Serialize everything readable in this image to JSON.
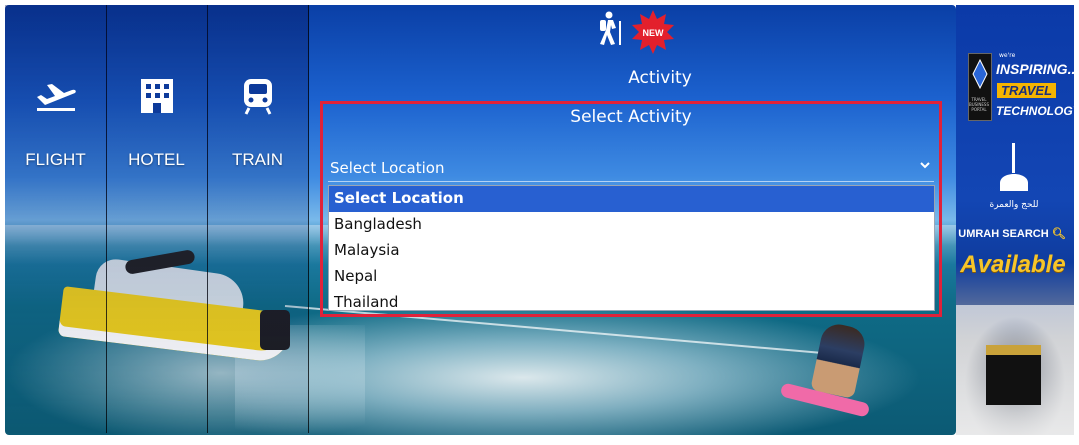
{
  "nav": {
    "tabs": [
      {
        "label": "FLIGHT",
        "icon": "airplane-departure-icon"
      },
      {
        "label": "HOTEL",
        "icon": "hotel-building-icon"
      },
      {
        "label": "TRAIN",
        "icon": "train-icon"
      }
    ]
  },
  "activity": {
    "label": "Activity",
    "icon": "hiker-icon",
    "badge": "NEW",
    "panel_title": "Select Activity",
    "location_select": {
      "value": "Select Location",
      "options": [
        "Select Location",
        "Bangladesh",
        "Malaysia",
        "Nepal",
        "Thailand"
      ],
      "selected_index": 0
    }
  },
  "ad": {
    "top_small": "we're",
    "inspiring": "INSPIRING...",
    "travel": "TRAVEL",
    "technology": "TECHNOLOGY",
    "logo_text": "TRAVEL BUSINESS PORTAL",
    "arabic_text": "للحج والعمرة",
    "umrah_search": "UMRAH SEARCH",
    "available": "Available"
  },
  "colors": {
    "highlight_border": "#e0223a",
    "option_selected_bg": "#2860d1",
    "badge_red": "#e3202c",
    "ad_yellow": "#f7c52a"
  }
}
